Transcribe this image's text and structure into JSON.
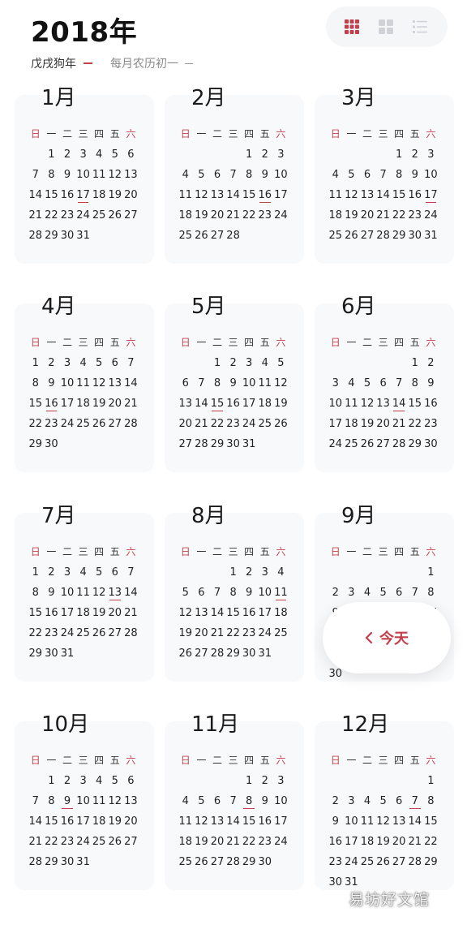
{
  "header": {
    "year_title": "2018年",
    "lunar_year": "戊戌狗年",
    "lunar_info": "每月农历初一"
  },
  "colors": {
    "accent": "#c33f4b",
    "card_bg": "#f8f9fb"
  },
  "view_modes": [
    {
      "name": "grid-9-icon",
      "active": true
    },
    {
      "name": "grid-4-icon",
      "active": false
    },
    {
      "name": "list-icon",
      "active": false
    }
  ],
  "weekdays": [
    "日",
    "一",
    "二",
    "三",
    "四",
    "五",
    "六"
  ],
  "months": [
    {
      "label": "1月",
      "first_weekday": 1,
      "days": 31,
      "highlight": 17
    },
    {
      "label": "2月",
      "first_weekday": 4,
      "days": 28,
      "highlight": 16
    },
    {
      "label": "3月",
      "first_weekday": 4,
      "days": 31,
      "highlight": 17
    },
    {
      "label": "4月",
      "first_weekday": 0,
      "days": 30,
      "highlight": 16
    },
    {
      "label": "5月",
      "first_weekday": 2,
      "days": 31,
      "highlight": 15
    },
    {
      "label": "6月",
      "first_weekday": 5,
      "days": 30,
      "highlight": 14
    },
    {
      "label": "7月",
      "first_weekday": 0,
      "days": 31,
      "highlight": 13
    },
    {
      "label": "8月",
      "first_weekday": 3,
      "days": 31,
      "highlight": 11
    },
    {
      "label": "9月",
      "first_weekday": 6,
      "days": 30,
      "highlight": 10
    },
    {
      "label": "10月",
      "first_weekday": 1,
      "days": 31,
      "highlight": 9
    },
    {
      "label": "11月",
      "first_weekday": 4,
      "days": 30,
      "highlight": 8
    },
    {
      "label": "12月",
      "first_weekday": 6,
      "days": 31,
      "highlight": 7
    }
  ],
  "today_button": {
    "label": "今天"
  },
  "watermark": "易坊好文馆"
}
